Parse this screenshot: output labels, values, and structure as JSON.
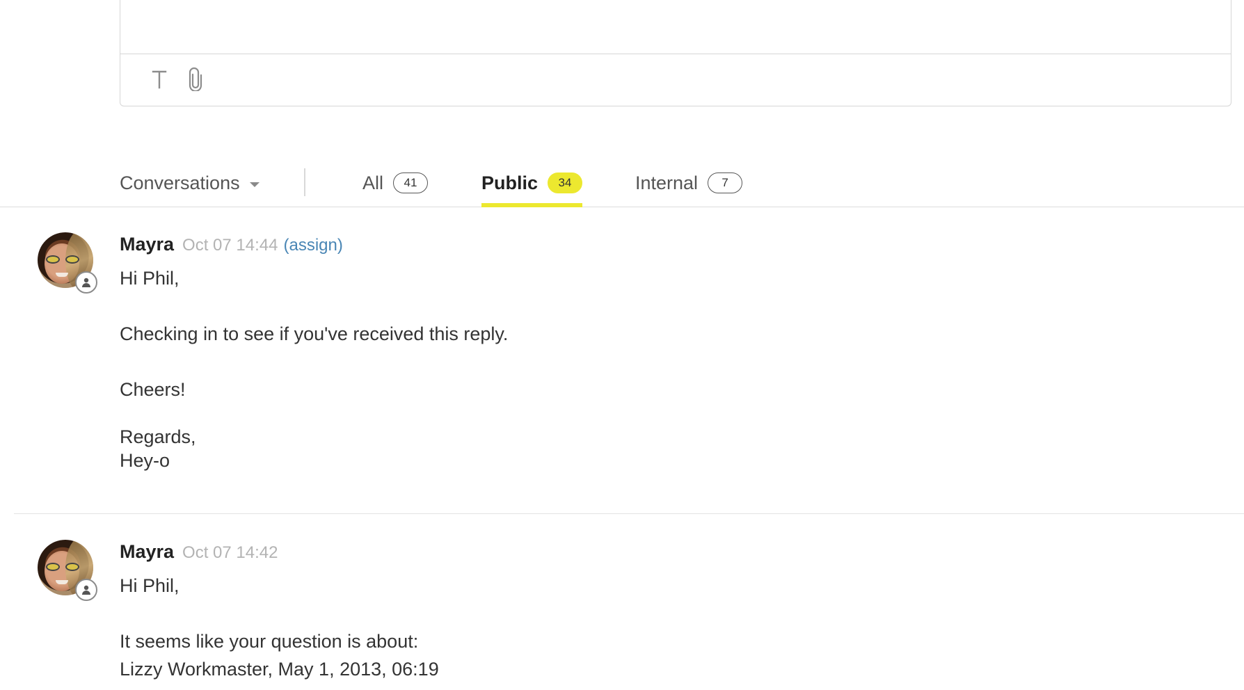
{
  "composer": {
    "text_value": "",
    "tools": [
      {
        "icon": "text-format-icon",
        "glyph": "T"
      },
      {
        "icon": "paperclip-icon"
      }
    ]
  },
  "tabs": {
    "dropdown_label": "Conversations",
    "items": [
      {
        "label": "All",
        "count": "41",
        "active": false
      },
      {
        "label": "Public",
        "count": "34",
        "active": true
      },
      {
        "label": "Internal",
        "count": "7",
        "active": false
      }
    ]
  },
  "colors": {
    "accent_yellow": "#ece82f",
    "link_blue": "#4a86b5",
    "timestamp_gray": "#b3b3b3"
  },
  "messages": [
    {
      "author": "Mayra",
      "timestamp": "Oct 07 14:44",
      "assign_label": "(assign)",
      "body": {
        "greeting": "Hi Phil,",
        "line1": "Checking in to see if you've received this reply.",
        "cheers": "Cheers!",
        "regards": "Regards,",
        "signature": "Hey-o"
      }
    },
    {
      "author": "Mayra",
      "timestamp": "Oct 07 14:42",
      "body": {
        "greeting": "Hi Phil,",
        "line1": "It seems like your question is about:",
        "line2": "Lizzy Workmaster, May 1, 2013, 06:19"
      }
    }
  ]
}
